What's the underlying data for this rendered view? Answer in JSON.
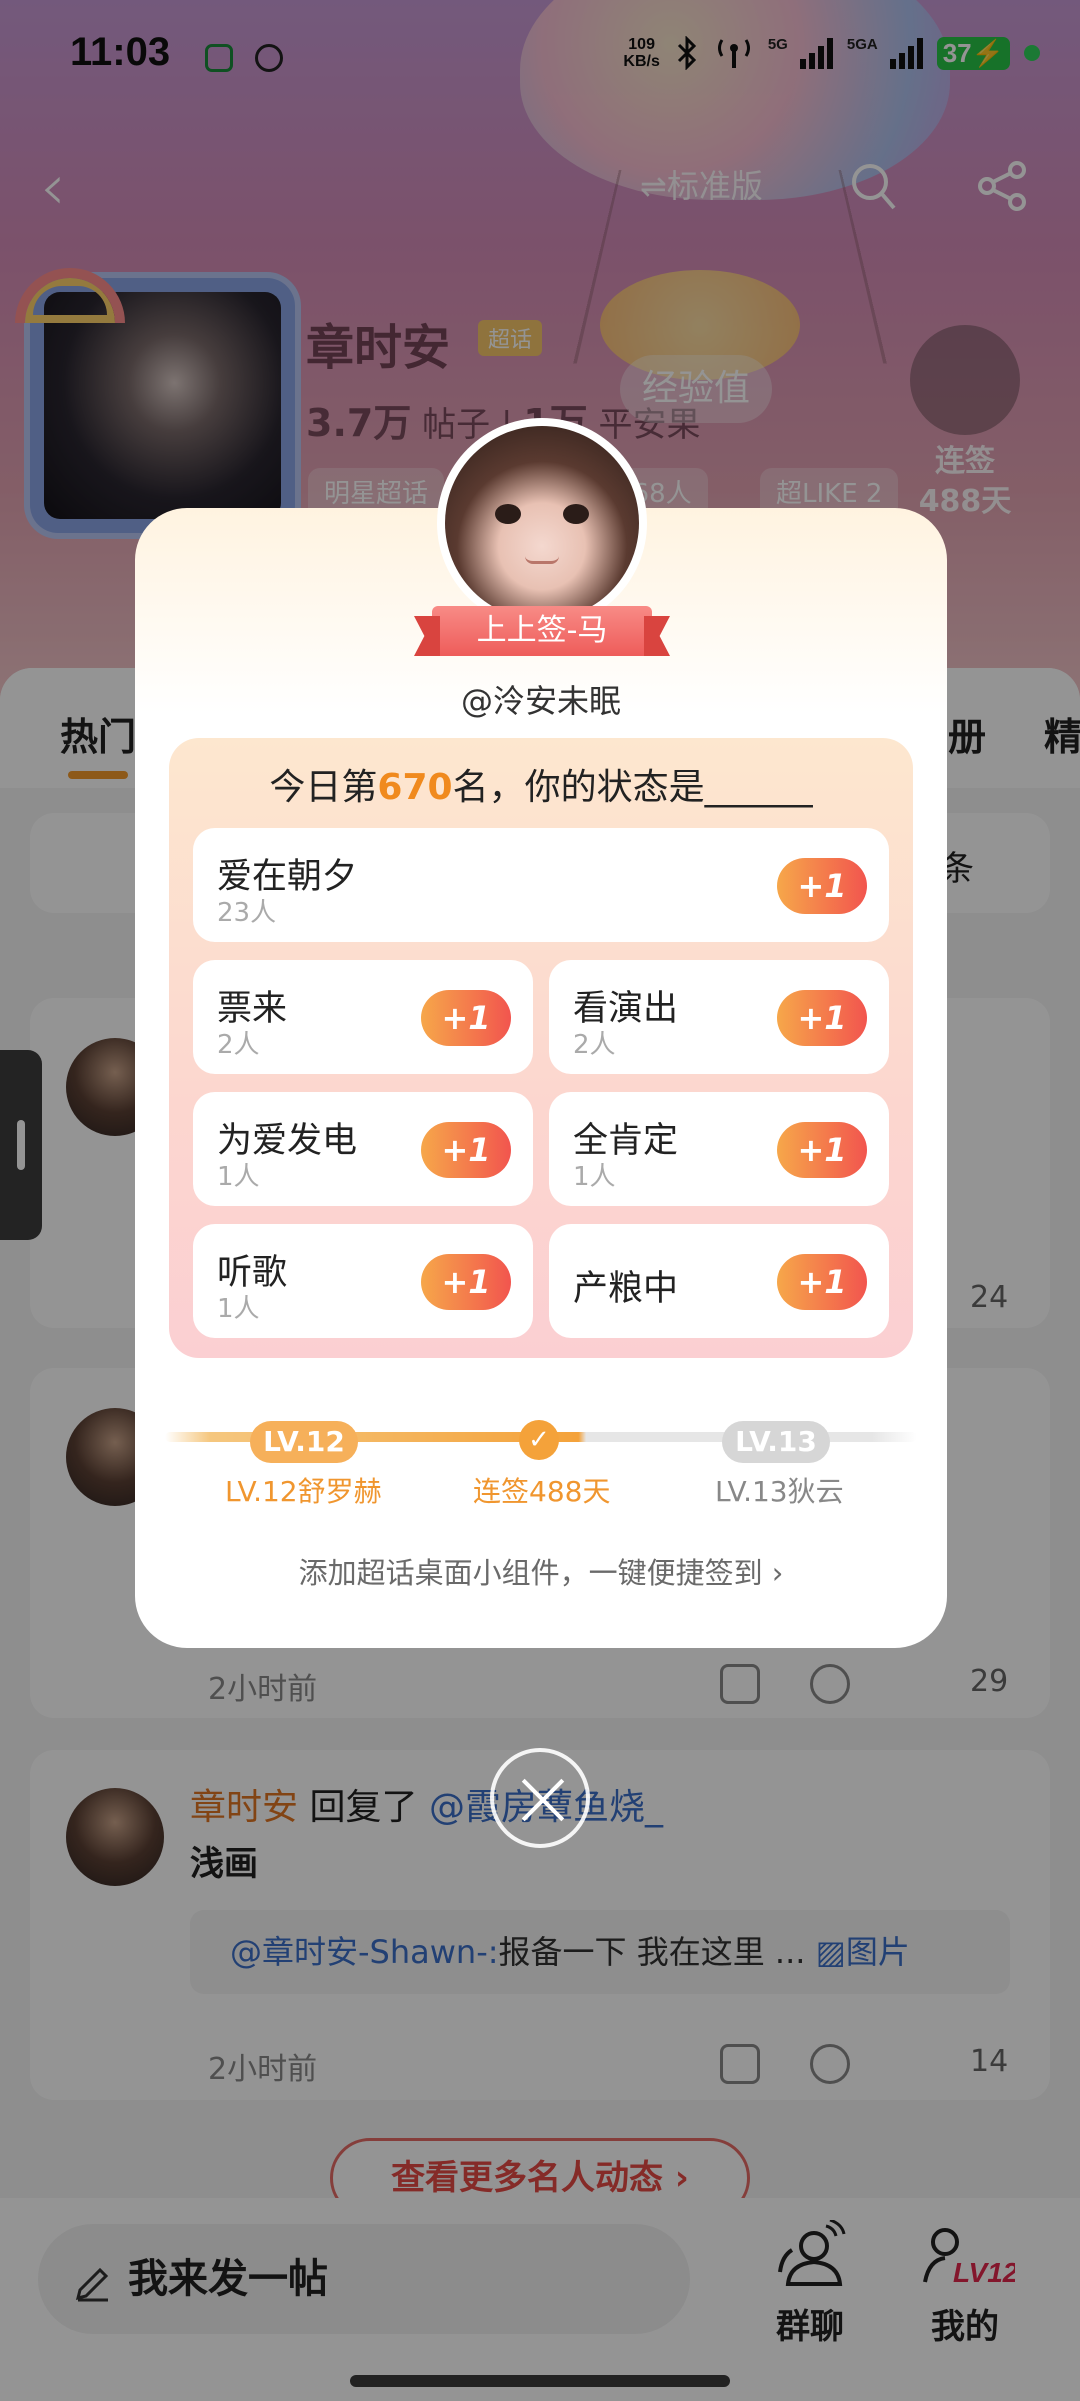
{
  "status_bar": {
    "time": "11:03",
    "net_speed_value": "109",
    "net_speed_unit": "KB/s",
    "signal1_label": "5G",
    "signal2_label": "5GA",
    "battery": "37"
  },
  "header": {
    "mode_label": "⇌标准版",
    "name": "章时安",
    "tag": "超话",
    "posts_count": "3.7万",
    "posts_label": "帖子",
    "fans_count": "1万",
    "fans_label": "平安果",
    "exp_label": "经验值",
    "sign_label_1": "连签",
    "sign_label_2": "488天",
    "tags": [
      "明星超话",
      "168人",
      "超LIKE 2"
    ]
  },
  "tabs": {
    "hot": "热门",
    "album": "册",
    "fine": "精"
  },
  "background_feed": {
    "pinned_suffix": "条",
    "card1_likes": "24",
    "card2_time": "2小时前",
    "card2_likes": "29",
    "card3_user": "章时安",
    "card3_replied": "回复了",
    "card3_mention": "@霞房蕈鱼烧_",
    "card3_text": "浅画",
    "card3_quote_mention": "@章时安-Shawn-:",
    "card3_quote_text": "报备一下 我在这里 ...",
    "card3_quote_pic": "图片",
    "card3_time": "2小时前",
    "card3_likes": "14",
    "more_button": "查看更多名人动态 ›"
  },
  "bottom_bar": {
    "post_placeholder": "我来发一帖",
    "group_chat": "群聊",
    "mine": "我的",
    "level_badge": "LV12"
  },
  "modal": {
    "ribbon": "上上签-马",
    "handle": "@泠安未眠",
    "question_prefix": "今日第",
    "rank": "670",
    "question_suffix": "名，你的状态是______",
    "options": [
      {
        "name": "爱在朝夕",
        "count": "23人",
        "plus": "+1"
      },
      {
        "name": "票来",
        "count": "2人",
        "plus": "+1"
      },
      {
        "name": "看演出",
        "count": "2人",
        "plus": "+1"
      },
      {
        "name": "为爱发电",
        "count": "1人",
        "plus": "+1"
      },
      {
        "name": "全肯定",
        "count": "1人",
        "plus": "+1"
      },
      {
        "name": "听歌",
        "count": "1人",
        "plus": "+1"
      },
      {
        "name": "产粮中",
        "count": "",
        "plus": "+1"
      }
    ],
    "level_current": "LV.12",
    "level_next": "LV.13",
    "level_current_label": "LV.12舒罗赫",
    "streak_label": "连签488天",
    "level_next_label": "LV.13狄云",
    "widget_link": "添加超话桌面小组件，一键便捷签到 ›"
  },
  "colors": {
    "accent_orange": "#f08a1e",
    "plus_gradient_start": "#f6a74a",
    "plus_gradient_end": "#f2554e",
    "ribbon_red": "#ee5c5a"
  }
}
